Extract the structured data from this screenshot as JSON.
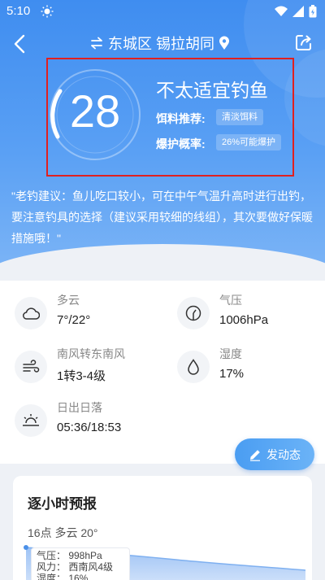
{
  "status": {
    "time": "5:10"
  },
  "nav": {
    "location": "东城区 锡拉胡同"
  },
  "fishing": {
    "score": "28",
    "verdict": "不太适宜钓鱼",
    "bait_label": "饵料推荐:",
    "bait_value": "清淡饵料",
    "explode_label": "爆护概率:",
    "explode_value": "26%可能爆护",
    "advice": "\"老钓建议：鱼儿吃口较小，可在中午气温升高时进行出钓，要注意钓具的选择（建议采用较细的线组），其次要做好保暖措施哦！\""
  },
  "weather": {
    "condition_label": "多云",
    "condition_value": "7°/22°",
    "pressure_label": "气压",
    "pressure_value": "1006hPa",
    "wind_label": "南风转东南风",
    "wind_value": "1转3-4级",
    "humidity_label": "湿度",
    "humidity_value": "17%",
    "sun_label": "日出日落",
    "sun_value": "05:36/18:53"
  },
  "post_button": "发动态",
  "hourly": {
    "title": "逐小时预报",
    "subtitle": "16点 多云 20°",
    "tooltip_pressure": "气压：  998hPa",
    "tooltip_wind": "风力：  西南风4级",
    "tooltip_humidity": "湿度：  16%"
  }
}
